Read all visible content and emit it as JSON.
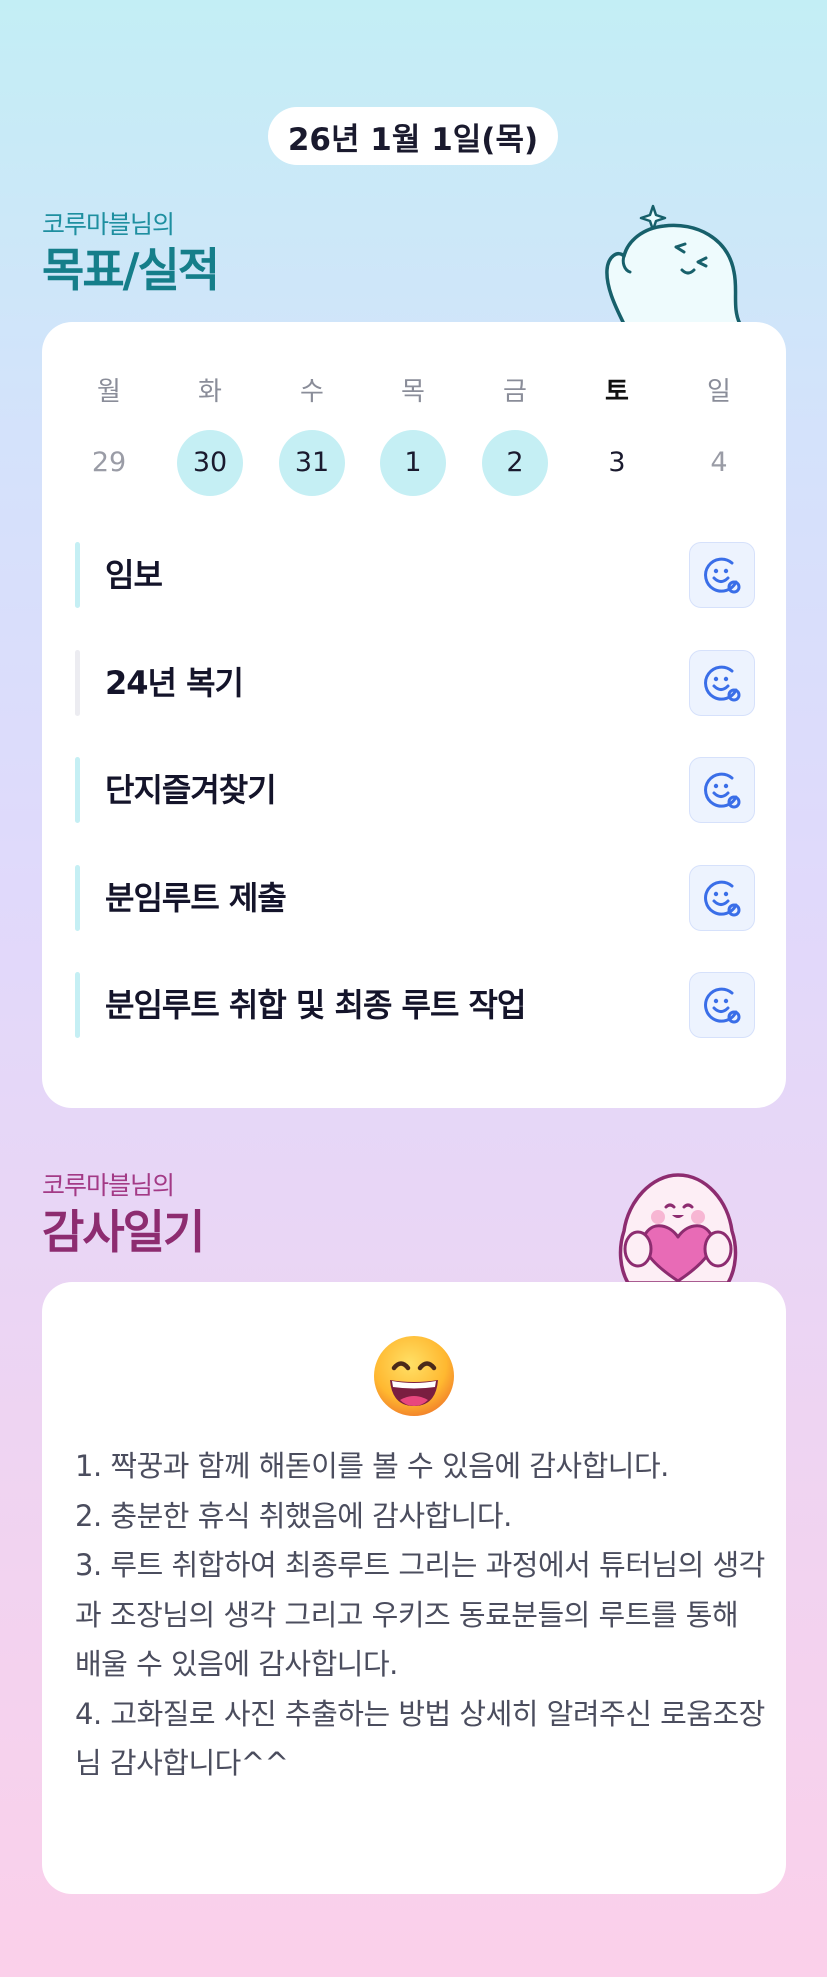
{
  "date_label": "26년 1월 1일(목)",
  "goals_section": {
    "subtitle": "코루마블님의",
    "title": "목표/실적"
  },
  "week": [
    {
      "day": "월",
      "date": "29",
      "state": "other"
    },
    {
      "day": "화",
      "date": "30",
      "state": "done"
    },
    {
      "day": "수",
      "date": "31",
      "state": "done"
    },
    {
      "day": "목",
      "date": "1",
      "state": "done"
    },
    {
      "day": "금",
      "date": "2",
      "state": "done"
    },
    {
      "day": "토",
      "date": "3",
      "state": "selected"
    },
    {
      "day": "일",
      "date": "4",
      "state": "other"
    }
  ],
  "goals": [
    {
      "label": "임보"
    },
    {
      "label": "24년 복기"
    },
    {
      "label": "단지즐겨찾기"
    },
    {
      "label": "분임루트 제출"
    },
    {
      "label": "분임루트 취합 및 최종 루트 작업"
    }
  ],
  "thanks_section": {
    "subtitle": "코루마블님의",
    "title": "감사일기",
    "emoji": "grinning-face",
    "text": "1. 짝꿍과 함께 해돋이를 볼 수 있음에 감사합니다.\n2. 충분한 휴식 취했음에 감사합니다.\n3. 루트 취합하여 최종루트 그리는 과정에서 튜터님의 생각과 조장님의 생각 그리고 우키즈 동료분들의 루트를 통해 배울 수 있음에 감사합니다.\n4. 고화질로 사진 추출하는 방법 상세히 알려주신 로움조장님 감사합니다^^"
  },
  "colors": {
    "accent_cyan": "#c5eff4",
    "goal_title": "#157e8a",
    "thanks_title": "#8d2c70",
    "icon_blue": "#3a6ee8"
  }
}
